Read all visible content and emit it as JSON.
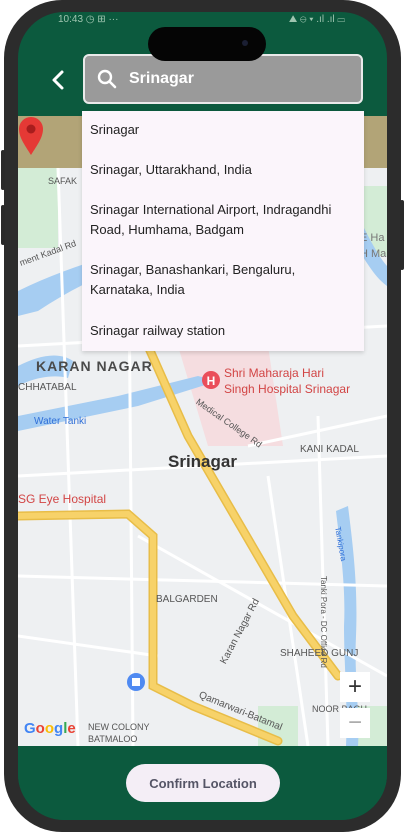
{
  "status_bar": {
    "left": "10:43 ◷ ⊞ ···",
    "right": "⛰ ⊖ ▾ .ıl .ıl ▭"
  },
  "search": {
    "value": "Srinagar"
  },
  "suggestions": [
    "Srinagar",
    "Srinagar, Uttarakhand, India",
    "Srinagar International Airport, Indragandhi Road, Humhama, Badgam",
    "Srinagar, Banashankari, Bengaluru, Karnataka, India",
    "Srinagar railway station"
  ],
  "map": {
    "labels": {
      "safak": "SAFAK",
      "kadal_rd": "ment Kadal Rd",
      "karan_nagar": "KARAN NAGAR",
      "chhatabal": "CHHATABAL",
      "water_tank": "Water Tanki",
      "hospital_line1": "Shri Maharaja Hari",
      "hospital_line2": "Singh Hospital Srinagar",
      "medical_college_rd": "Medical College Rd",
      "kani_kadal": "KANI KADAL",
      "city": "Srinagar",
      "eye_hospital": "SG Eye Hospital",
      "balgarden": "BALGARDEN",
      "karan_nagar_rd": "Karan Nagar Rd",
      "shaheed_gunj": "SHAHEED GUNJ",
      "qamarwari": "Qamarwari-Batamal",
      "new_colony": "NEW COLONY",
      "batmaloo": "BATMALOO",
      "noor_bagh": "NOOR BAGH",
      "tankipora": "Tankipora",
      "tanki_pora_rd": "Tanki Pora - DC Office Rd",
      "eha": "E Ha",
      "h_ma": "H Ma"
    },
    "zoom_in": "+",
    "zoom_out": "−",
    "google": [
      "G",
      "o",
      "o",
      "g",
      "l",
      "e"
    ],
    "google_colors": [
      "#4285F4",
      "#EA4335",
      "#FBBC05",
      "#4285F4",
      "#34A853",
      "#EA4335"
    ]
  },
  "confirm_button": {
    "label": "Confirm Location"
  },
  "colors": {
    "brand_green": "#0c5a3e",
    "road": "#f7d269",
    "water": "#a6cdf2",
    "pin": "#e53935"
  }
}
